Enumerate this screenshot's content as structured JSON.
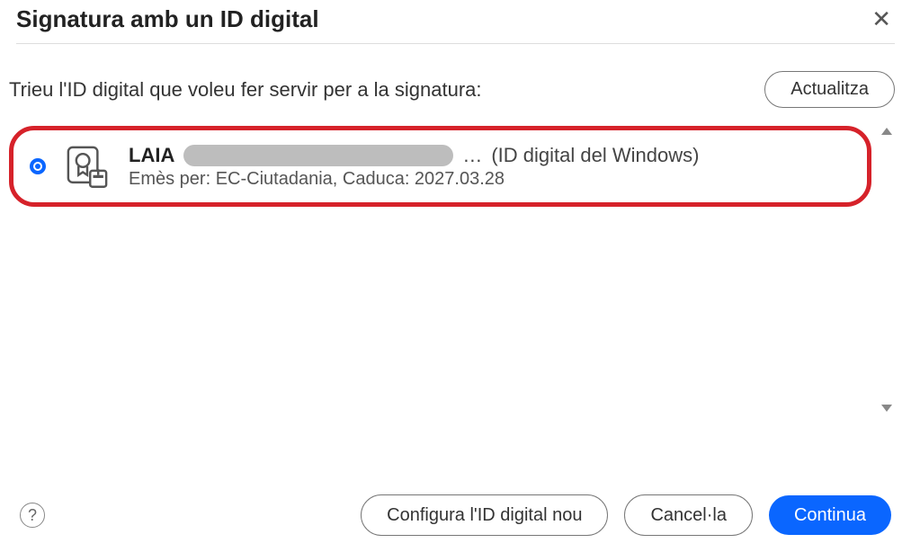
{
  "header": {
    "title": "Signatura amb un ID digital"
  },
  "subtitle": "Trieu l'ID digital que voleu fer servir per a la signatura:",
  "buttons": {
    "refresh": "Actualitza",
    "configure": "Configura l'ID digital nou",
    "cancel": "Cancel·la",
    "continue": "Continua"
  },
  "certificate": {
    "name": "LAIA",
    "ellipsis": "…",
    "source": "(ID digital del Windows)",
    "details": "Emès per: EC-Ciutadania, Caduca: 2027.03.28"
  }
}
